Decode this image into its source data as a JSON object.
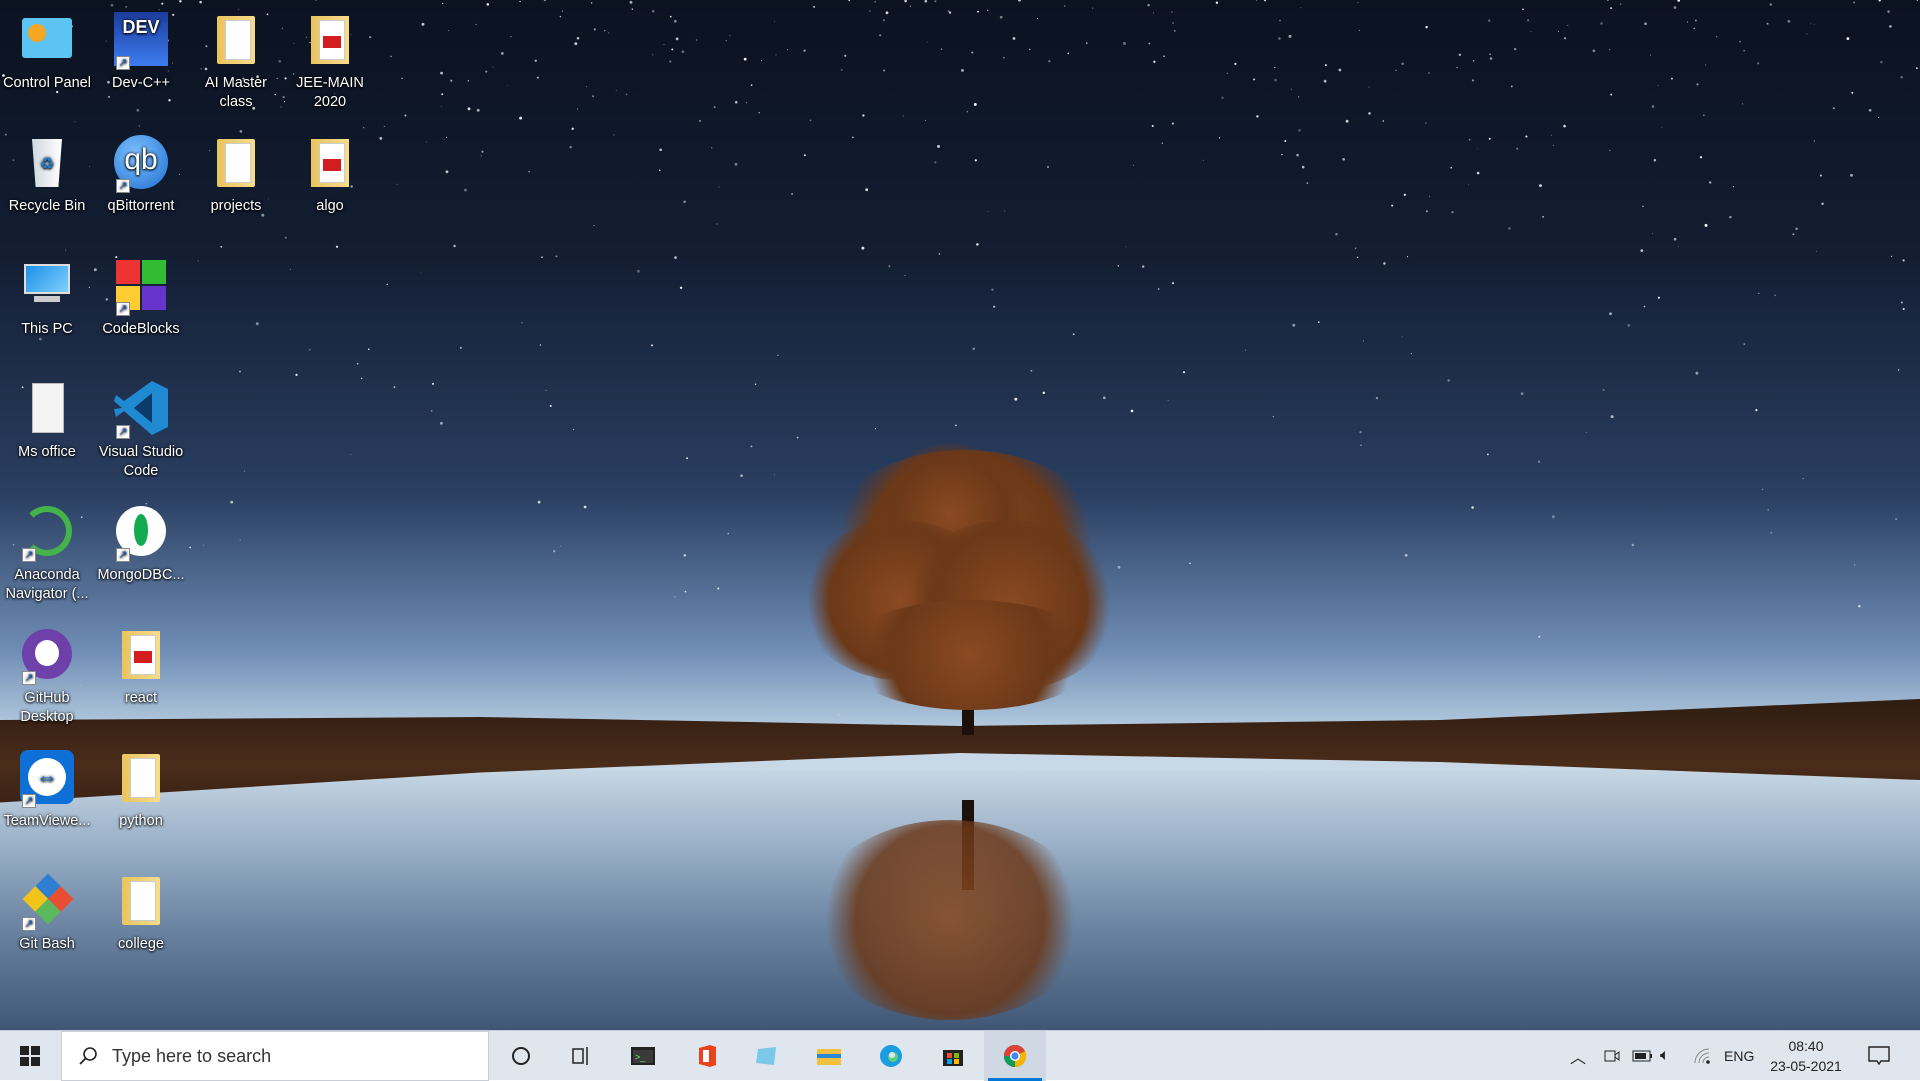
{
  "desktop": {
    "columns": [
      [
        {
          "label": "Control Panel",
          "icon": "control-panel-icon",
          "shortcut": false
        },
        {
          "label": "Recycle Bin",
          "icon": "recycle-bin-icon",
          "shortcut": false
        },
        {
          "label": "This PC",
          "icon": "this-pc-icon",
          "shortcut": false
        },
        {
          "label": "Ms office",
          "icon": "document-icon",
          "shortcut": false
        },
        {
          "label": "Anaconda Navigator (...",
          "icon": "anaconda-icon",
          "shortcut": true
        },
        {
          "label": "GitHub Desktop",
          "icon": "github-icon",
          "shortcut": true
        },
        {
          "label": "TeamViewe...",
          "icon": "teamviewer-icon",
          "shortcut": true
        },
        {
          "label": "Git Bash",
          "icon": "git-icon",
          "shortcut": true
        }
      ],
      [
        {
          "label": "Dev-C++",
          "icon": "devcpp-icon",
          "shortcut": true
        },
        {
          "label": "qBittorrent",
          "icon": "qbittorrent-icon",
          "shortcut": true
        },
        {
          "label": "CodeBlocks",
          "icon": "codeblocks-icon",
          "shortcut": true
        },
        {
          "label": "Visual Studio Code",
          "icon": "vscode-icon",
          "shortcut": true
        },
        {
          "label": "MongoDBC...",
          "icon": "mongodb-icon",
          "shortcut": true
        },
        {
          "label": "react",
          "icon": "pdf-folder-icon",
          "shortcut": false
        },
        {
          "label": "python",
          "icon": "folder-icon",
          "shortcut": false
        },
        {
          "label": "college",
          "icon": "folder-icon",
          "shortcut": false
        }
      ],
      [
        {
          "label": "AI Master class",
          "icon": "folder-icon",
          "shortcut": false
        },
        {
          "label": "projects",
          "icon": "folder-icon",
          "shortcut": false
        }
      ],
      [
        {
          "label": "JEE-MAIN 2020",
          "icon": "pdf-folder-icon",
          "shortcut": false
        },
        {
          "label": "algo",
          "icon": "pdf-folder-icon",
          "shortcut": false
        }
      ]
    ]
  },
  "taskbar": {
    "search_placeholder": "Type here to search",
    "apps": [
      {
        "name": "cortana-icon"
      },
      {
        "name": "task-view-icon"
      },
      {
        "name": "terminal-icon"
      },
      {
        "name": "office-icon"
      },
      {
        "name": "notepad-icon"
      },
      {
        "name": "file-explorer-icon"
      },
      {
        "name": "edge-icon"
      },
      {
        "name": "store-icon"
      },
      {
        "name": "chrome-icon",
        "active": true
      }
    ],
    "tray": {
      "language": "ENG",
      "time": "08:40",
      "date": "23-05-2021"
    },
    "accent": "#0078d7"
  }
}
